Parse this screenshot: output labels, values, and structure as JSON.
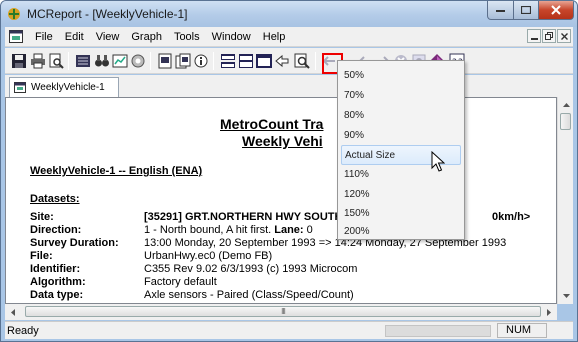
{
  "window": {
    "title": "MCReport - [WeeklyVehicle-1]"
  },
  "menu": {
    "items": [
      "File",
      "Edit",
      "View",
      "Graph",
      "Tools",
      "Window",
      "Help"
    ]
  },
  "tab": {
    "label": "WeeklyVehicle-1"
  },
  "report": {
    "title_line1": "MetroCount Tra",
    "title_line2": "Weekly Vehi",
    "subtitle": "WeeklyVehicle-1 -- English (ENA)",
    "datasets_heading": "Datasets:",
    "fields": [
      {
        "label": "Site:",
        "value": "[35291] GRT.NORTHERN HWY SOUTH",
        "extra": "0km/h>"
      },
      {
        "label": "Direction:",
        "value": "1 - North bound, A hit first.",
        "value_bold": "Lane:",
        "value_tail": " 0"
      },
      {
        "label": "Survey Duration:",
        "value": "13:00 Monday, 20 September 1993 => 14:24 Monday, 27 September 1993"
      },
      {
        "label": "File:",
        "value": "UrbanHwy.ec0 (Demo FB)"
      },
      {
        "label": "Identifier:",
        "value": "C355 Rev 9.02 6/3/1993 (c) 1993 Microcom"
      },
      {
        "label": "Algorithm:",
        "value": "Factory default"
      },
      {
        "label": "Data type:",
        "value": "Axle sensors - Paired (Class/Speed/Count)"
      }
    ]
  },
  "zoom_menu": {
    "options": [
      "50%",
      "70%",
      "80%",
      "90%",
      "Actual Size",
      "110%",
      "120%",
      "150%",
      "200%"
    ],
    "highlighted_index": 4
  },
  "scrollbar": {
    "thumb_grip": "III"
  },
  "status": {
    "text": "Ready",
    "num": "NUM"
  },
  "colors": {
    "highlight_box": "#e00000",
    "title_bar": "#b3cbe8",
    "close_button": "#c7452b"
  }
}
